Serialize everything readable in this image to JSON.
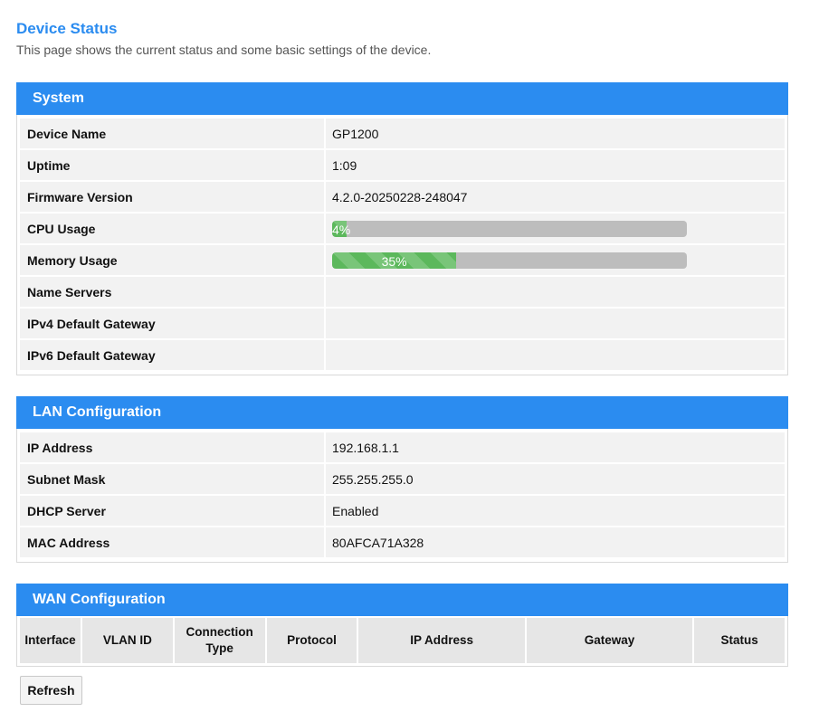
{
  "page": {
    "title": "Device Status",
    "description": "This page shows the current status and some basic settings of the device."
  },
  "system": {
    "header": "System",
    "rows": [
      {
        "label": "Device Name",
        "value": "GP1200"
      },
      {
        "label": "Uptime",
        "value": "1:09"
      },
      {
        "label": "Firmware Version",
        "value": "4.2.0-20250228-248047"
      },
      {
        "label": "CPU Usage",
        "percent": 4,
        "text": "4%"
      },
      {
        "label": "Memory Usage",
        "percent": 35,
        "text": "35%"
      },
      {
        "label": "Name Servers",
        "value": ""
      },
      {
        "label": "IPv4 Default Gateway",
        "value": ""
      },
      {
        "label": "IPv6 Default Gateway",
        "value": ""
      }
    ]
  },
  "lan": {
    "header": "LAN Configuration",
    "rows": [
      {
        "label": "IP Address",
        "value": "192.168.1.1"
      },
      {
        "label": "Subnet Mask",
        "value": "255.255.255.0"
      },
      {
        "label": "DHCP Server",
        "value": "Enabled"
      },
      {
        "label": "MAC Address",
        "value": "80AFCA71A328"
      }
    ]
  },
  "wan": {
    "header": "WAN Configuration",
    "columns": [
      "Interface",
      "VLAN ID",
      "Connection Type",
      "Protocol",
      "IP Address",
      "Gateway",
      "Status"
    ]
  },
  "actions": {
    "refresh_label": "Refresh"
  },
  "colors": {
    "accent": "#2b8cf0",
    "progress": "#5cb85c",
    "progress_track": "#bdbdbd"
  }
}
